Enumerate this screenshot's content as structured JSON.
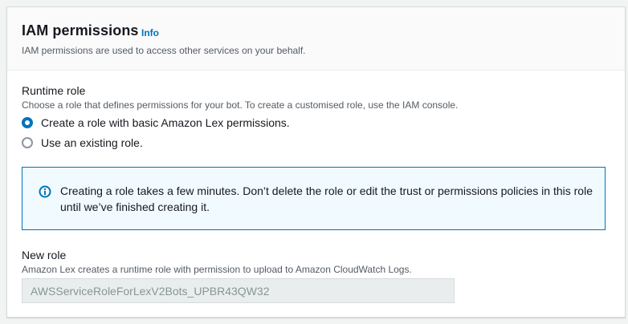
{
  "panel": {
    "title": "IAM permissions",
    "info_link": "Info",
    "description": "IAM permissions are used to access other services on your behalf."
  },
  "runtime_role": {
    "label": "Runtime role",
    "description": "Choose a role that defines permissions for your bot. To create a customised role, use the IAM console.",
    "options": [
      {
        "label": "Create a role with basic Amazon Lex permissions.",
        "selected": true
      },
      {
        "label": "Use an existing role.",
        "selected": false
      }
    ]
  },
  "alert": {
    "icon": "info-circle-icon",
    "text": "Creating a role takes a few minutes. Don’t delete the role or edit the trust or permissions policies in this role until we’ve finished creating it."
  },
  "new_role": {
    "label": "New role",
    "description": "Amazon Lex creates a runtime role with permission to upload to Amazon CloudWatch Logs.",
    "value": "AWSServiceRoleForLexV2Bots_UPBR43QW32"
  },
  "colors": {
    "accent": "#0073bb",
    "alert_background": "#f1faff",
    "page_background": "#f2f3f3"
  }
}
